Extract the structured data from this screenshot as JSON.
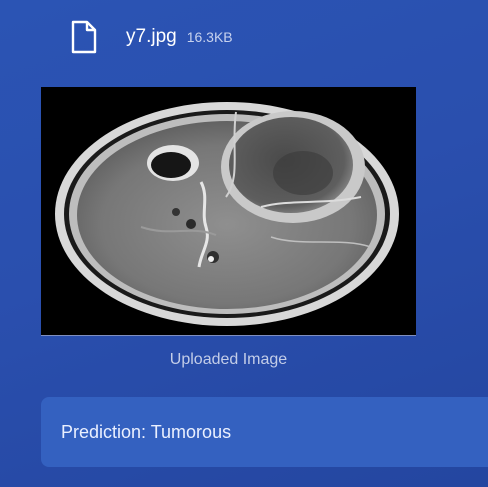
{
  "file": {
    "icon": "file-icon",
    "name": "y7.jpg",
    "size": "16.3KB"
  },
  "image": {
    "caption": "Uploaded Image",
    "alt": "brain MRI scan"
  },
  "result": {
    "text": "Prediction: Tumorous"
  },
  "colors": {
    "background": "#2b54b4",
    "result_box": "#3461c0",
    "muted_text": "#c3cde8"
  }
}
